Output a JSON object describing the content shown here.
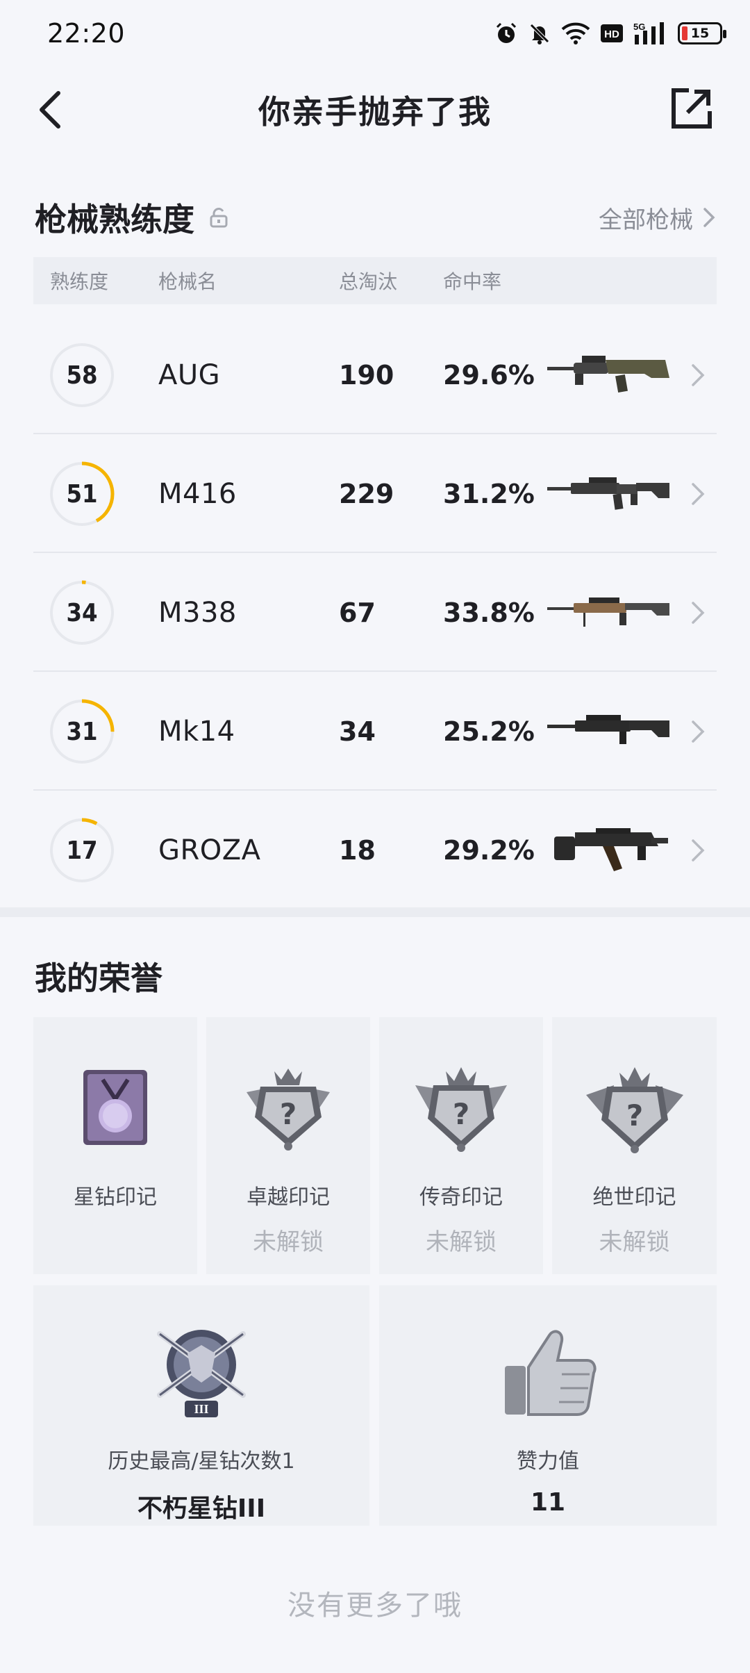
{
  "status_bar": {
    "time": "22:20",
    "battery": "15",
    "network": "5G"
  },
  "header": {
    "title": "你亲手抛弃了我"
  },
  "weapons": {
    "title": "枪械熟练度",
    "see_all": "全部枪械",
    "columns": {
      "proficiency": "熟练度",
      "name": "枪械名",
      "kills": "总淘汰",
      "accuracy": "命中率"
    },
    "rows": [
      {
        "proficiency": "58",
        "progress": 0.0,
        "name": "AUG",
        "kills": "190",
        "accuracy": "29.6%"
      },
      {
        "proficiency": "51",
        "progress": 0.42,
        "name": "M416",
        "kills": "229",
        "accuracy": "31.2%"
      },
      {
        "proficiency": "34",
        "progress": 0.02,
        "name": "M338",
        "kills": "67",
        "accuracy": "33.8%"
      },
      {
        "proficiency": "31",
        "progress": 0.25,
        "name": "Mk14",
        "kills": "34",
        "accuracy": "25.2%"
      },
      {
        "proficiency": "17",
        "progress": 0.08,
        "name": "GROZA",
        "kills": "18",
        "accuracy": "29.2%"
      }
    ]
  },
  "honors": {
    "title": "我的荣誉",
    "badges": [
      {
        "label": "星钻印记",
        "status": ""
      },
      {
        "label": "卓越印记",
        "status": "未解锁"
      },
      {
        "label": "传奇印记",
        "status": "未解锁"
      },
      {
        "label": "绝世印记",
        "status": "未解锁"
      }
    ],
    "cards": [
      {
        "label": "历史最高/星钻次数1",
        "value": "不朽星钻III",
        "badge_mark": "III"
      },
      {
        "label": "赞力值",
        "value": "11"
      }
    ]
  },
  "footer": {
    "text": "没有更多了哦"
  },
  "colors": {
    "accent_ring": "#f5b400",
    "ring_track": "#e6e8ed"
  }
}
